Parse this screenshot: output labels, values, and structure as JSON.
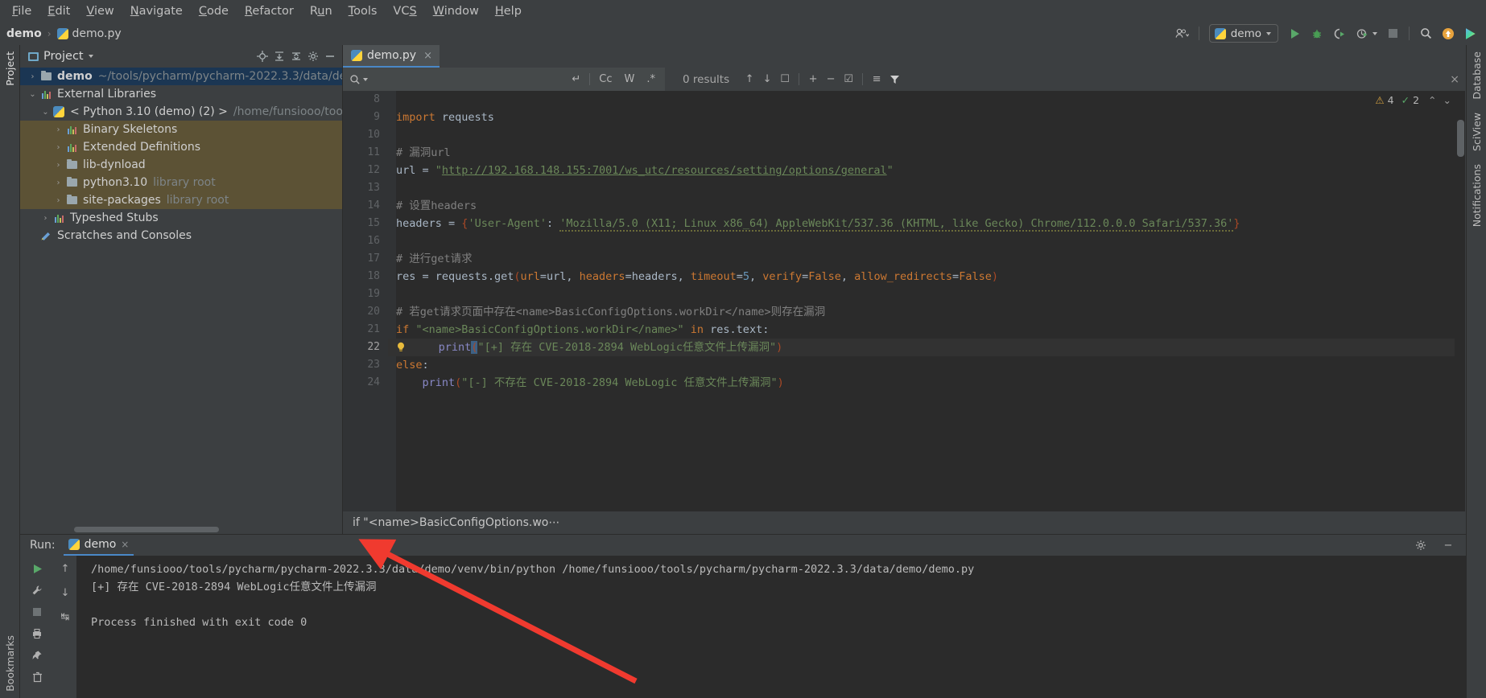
{
  "menu": {
    "items": [
      "File",
      "Edit",
      "View",
      "Navigate",
      "Code",
      "Refactor",
      "Run",
      "Tools",
      "VCS",
      "Window",
      "Help"
    ]
  },
  "navbar": {
    "project_name": "demo",
    "separator": "›",
    "file_name": "demo.py",
    "run_config": "demo",
    "icons": {
      "user": "user-icon",
      "run": "run-icon",
      "debug": "debug-icon",
      "coverage": "coverage-icon",
      "profile": "profile-icon",
      "stop": "stop-icon",
      "search": "search-everywhere-icon",
      "update": "update-icon",
      "aiassist": "ai-assistant-icon"
    }
  },
  "left_strips": {
    "top": [
      "Project"
    ],
    "bottom": [
      "Bookmarks"
    ]
  },
  "right_strips": {
    "items": [
      "Database",
      "SciView",
      "Notifications"
    ]
  },
  "project_panel": {
    "title": "Project",
    "header_icons": [
      "locate-icon",
      "expand-all-icon",
      "collapse-all-icon",
      "settings-gear-icon",
      "hide-icon"
    ],
    "tree": [
      {
        "label": "demo",
        "detail": "~/tools/pycharm/pycharm-2022.3.3/data/de",
        "indent": 0,
        "arrow": "›",
        "icon": "folder-icon",
        "bold": true,
        "selected": "blue"
      },
      {
        "label": "External Libraries",
        "detail": "",
        "indent": 0,
        "arrow": "⌄",
        "icon": "library-icon",
        "bold": false,
        "selected": ""
      },
      {
        "label": "< Python 3.10 (demo) (2) >",
        "detail": "/home/funsiooo/tools",
        "indent": 1,
        "arrow": "⌄",
        "icon": "python-icon",
        "bold": false,
        "selected": ""
      },
      {
        "label": "Binary Skeletons",
        "detail": "",
        "indent": 2,
        "arrow": "›",
        "icon": "library-icon",
        "bold": false,
        "selected": "olive"
      },
      {
        "label": "Extended Definitions",
        "detail": "",
        "indent": 2,
        "arrow": "›",
        "icon": "library-icon",
        "bold": false,
        "selected": "olive"
      },
      {
        "label": "lib-dynload",
        "detail": "",
        "indent": 2,
        "arrow": "›",
        "icon": "folder-icon",
        "bold": false,
        "selected": "olive"
      },
      {
        "label": "python3.10",
        "detail": "library root",
        "indent": 2,
        "arrow": "›",
        "icon": "folder-icon",
        "bold": false,
        "selected": "olive"
      },
      {
        "label": "site-packages",
        "detail": "library root",
        "indent": 2,
        "arrow": "›",
        "icon": "folder-icon",
        "bold": false,
        "selected": "olive"
      },
      {
        "label": "Typeshed Stubs",
        "detail": "",
        "indent": 1,
        "arrow": "›",
        "icon": "library-icon",
        "bold": false,
        "selected": ""
      },
      {
        "label": "Scratches and Consoles",
        "detail": "",
        "indent": 0,
        "arrow": "",
        "icon": "scratch-icon",
        "bold": false,
        "selected": ""
      }
    ]
  },
  "editor": {
    "tab_label": "demo.py",
    "tab_close": "×",
    "findbar": {
      "placeholder": "",
      "value": "",
      "results": "0 results",
      "opts": [
        "Cc",
        "W",
        ".*"
      ],
      "icons": [
        "find-dropdown-icon",
        "new-line-icon",
        "prev-match-icon",
        "next-match-icon",
        "select-all-icon",
        "add-selection-icon",
        "remove-selection-icon",
        "select-all-occurrences-icon",
        "filter-options-icon",
        "filter-icon",
        "close-icon"
      ]
    },
    "inspections": {
      "warnings": "4",
      "checks": "2"
    },
    "first_line_number": 8,
    "lines": [
      {
        "n": 8,
        "tokens": [],
        "highlight": false,
        "bulb": false
      },
      {
        "n": 9,
        "tokens": [
          {
            "t": "import ",
            "c": "kw"
          },
          {
            "t": "requests",
            "c": ""
          }
        ],
        "highlight": false,
        "bulb": false
      },
      {
        "n": 10,
        "tokens": [],
        "highlight": false,
        "bulb": false
      },
      {
        "n": 11,
        "tokens": [
          {
            "t": "# 漏洞url",
            "c": "cmt"
          }
        ],
        "highlight": false,
        "bulb": false
      },
      {
        "n": 12,
        "tokens": [
          {
            "t": "url ",
            "c": ""
          },
          {
            "t": "= ",
            "c": ""
          },
          {
            "t": "\"",
            "c": "str"
          },
          {
            "t": "http://192.168.148.155:7001/ws_utc/resources/setting/options/general",
            "c": "url"
          },
          {
            "t": "\"",
            "c": "str"
          }
        ],
        "highlight": false,
        "bulb": false
      },
      {
        "n": 13,
        "tokens": [],
        "highlight": false,
        "bulb": false
      },
      {
        "n": 14,
        "tokens": [
          {
            "t": "# 设置headers",
            "c": "cmt"
          }
        ],
        "highlight": false,
        "bulb": false
      },
      {
        "n": 15,
        "tokens": [
          {
            "t": "headers ",
            "c": ""
          },
          {
            "t": "= ",
            "c": ""
          },
          {
            "t": "{",
            "c": "par"
          },
          {
            "t": "'User-Agent'",
            "c": "str"
          },
          {
            "t": ": ",
            "c": ""
          },
          {
            "t": "'Mozilla/5.0 (X11; Linux x86_64) AppleWebKit/537.36 (KHTML, like Gecko) Chrome/112.0.0.0 Safari/537.36'",
            "c": "str wavy"
          },
          {
            "t": "}",
            "c": "par"
          }
        ],
        "highlight": false,
        "bulb": false
      },
      {
        "n": 16,
        "tokens": [],
        "highlight": false,
        "bulb": false
      },
      {
        "n": 17,
        "tokens": [
          {
            "t": "# 进行get请求",
            "c": "cmt"
          }
        ],
        "highlight": false,
        "bulb": false
      },
      {
        "n": 18,
        "tokens": [
          {
            "t": "res ",
            "c": ""
          },
          {
            "t": "= ",
            "c": ""
          },
          {
            "t": "requests",
            "c": ""
          },
          {
            "t": ".",
            "c": ""
          },
          {
            "t": "get",
            "c": ""
          },
          {
            "t": "(",
            "c": "par"
          },
          {
            "t": "url",
            "c": "kw"
          },
          {
            "t": "=url, ",
            "c": ""
          },
          {
            "t": "headers",
            "c": "kw"
          },
          {
            "t": "=headers, ",
            "c": ""
          },
          {
            "t": "timeout",
            "c": "kw"
          },
          {
            "t": "=",
            "c": ""
          },
          {
            "t": "5",
            "c": "num"
          },
          {
            "t": ", ",
            "c": ""
          },
          {
            "t": "verify",
            "c": "kw"
          },
          {
            "t": "=",
            "c": ""
          },
          {
            "t": "False",
            "c": "kw"
          },
          {
            "t": ", ",
            "c": ""
          },
          {
            "t": "allow_redirects",
            "c": "kw"
          },
          {
            "t": "=",
            "c": ""
          },
          {
            "t": "False",
            "c": "kw"
          },
          {
            "t": ")",
            "c": "par"
          }
        ],
        "highlight": false,
        "bulb": false
      },
      {
        "n": 19,
        "tokens": [],
        "highlight": false,
        "bulb": false
      },
      {
        "n": 20,
        "tokens": [
          {
            "t": "# 若get请求页面中存在<name>BasicConfigOptions.workDir</name>则存在漏洞",
            "c": "cmt"
          }
        ],
        "highlight": false,
        "bulb": false
      },
      {
        "n": 21,
        "tokens": [
          {
            "t": "if ",
            "c": "kw"
          },
          {
            "t": "\"<name>BasicConfigOptions.workDir</name>\"",
            "c": "str"
          },
          {
            "t": " ",
            "c": ""
          },
          {
            "t": "in ",
            "c": "kw"
          },
          {
            "t": "res.text:",
            "c": ""
          }
        ],
        "highlight": false,
        "bulb": false
      },
      {
        "n": 22,
        "tokens": [
          {
            "t": "    ",
            "c": ""
          },
          {
            "t": "print",
            "c": "bi"
          },
          {
            "t": "(",
            "c": "cursor"
          },
          {
            "t": "\"[+] 存在 CVE-2018-2894 WebLogic任意文件上传漏洞\"",
            "c": "str"
          },
          {
            "t": ")",
            "c": "par"
          }
        ],
        "highlight": true,
        "bulb": true
      },
      {
        "n": 23,
        "tokens": [
          {
            "t": "else",
            "c": "kw"
          },
          {
            "t": ":",
            "c": ""
          }
        ],
        "highlight": false,
        "bulb": false
      },
      {
        "n": 24,
        "tokens": [
          {
            "t": "    ",
            "c": ""
          },
          {
            "t": "print",
            "c": "bi"
          },
          {
            "t": "(",
            "c": "par"
          },
          {
            "t": "\"[-] 不存在 CVE-2018-2894 WebLogic 任意文件上传漏洞\"",
            "c": "str"
          },
          {
            "t": ")",
            "c": "par"
          }
        ],
        "highlight": false,
        "bulb": false
      }
    ],
    "breadcrumb": "if \"<name>BasicConfigOptions.wo⋯"
  },
  "run_panel": {
    "label": "Run:",
    "tab": "demo",
    "tab_close": "×",
    "left_tools": [
      "rerun-icon",
      "wrench-settings-icon",
      "stop-icon",
      "print-icon",
      "pin-icon",
      "trash-icon"
    ],
    "second_tools": [
      "scroll-up-icon",
      "scroll-down-icon",
      "soft-wrap-icon"
    ],
    "right_tools": [
      "settings-gear-icon",
      "hide-icon"
    ],
    "console": [
      "/home/funsiooo/tools/pycharm/pycharm-2022.3.3/data/demo/venv/bin/python /home/funsiooo/tools/pycharm/pycharm-2022.3.3/data/demo/demo.py",
      "[+] 存在 CVE-2018-2894 WebLogic任意文件上传漏洞",
      "",
      "Process finished with exit code 0"
    ]
  },
  "colors": {
    "accent": "#4a88c7",
    "bg_panel": "#3c3f41",
    "bg_editor": "#2b2b2b",
    "selection_blue": "#1b3653",
    "selection_olive": "#5c5235",
    "string": "#6a8759",
    "keyword": "#cc7832",
    "number": "#6897bb",
    "comment": "#808080",
    "annotation_arrow": "#f03a2f"
  }
}
